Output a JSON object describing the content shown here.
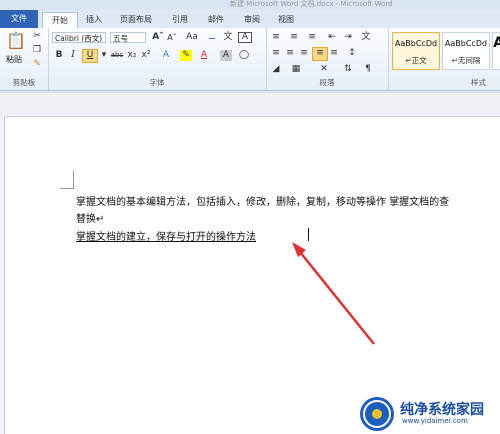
{
  "window": {
    "title": "新建 Microsoft Word 文档.docx - Microsoft Word"
  },
  "tabs": [
    {
      "label": "文件"
    },
    {
      "label": "开始"
    },
    {
      "label": "插入"
    },
    {
      "label": "页面布局"
    },
    {
      "label": "引用"
    },
    {
      "label": "邮件"
    },
    {
      "label": "审阅"
    },
    {
      "label": "视图"
    }
  ],
  "ribbon": {
    "clipboard": {
      "paste": "粘贴",
      "label": "剪贴板"
    },
    "font": {
      "name": "Calibri (西文)",
      "size": "五号",
      "label": "字体"
    },
    "paragraph": {
      "label": "段落"
    },
    "styles": {
      "label": "样式",
      "items": [
        {
          "sample": "AaBbCcDd",
          "name": "↵正文"
        },
        {
          "sample": "AaBbCcDd",
          "name": "↵无间隔"
        },
        {
          "sample": "A",
          "name": ""
        }
      ]
    }
  },
  "document": {
    "lines": [
      "掌握文档的基本编辑方法，包括插入，修改，删除，复制，移动等操作 掌握文档的查",
      "替换↵",
      "掌握文档的建立，保存与打开的操作方法"
    ]
  },
  "watermark": {
    "text": "纯净系统家园",
    "url": "www.yidaimei.com"
  },
  "colors": {
    "file_tab": "#2f64b6",
    "arrow": "#e03030",
    "watermark": "#1a4fa0"
  }
}
